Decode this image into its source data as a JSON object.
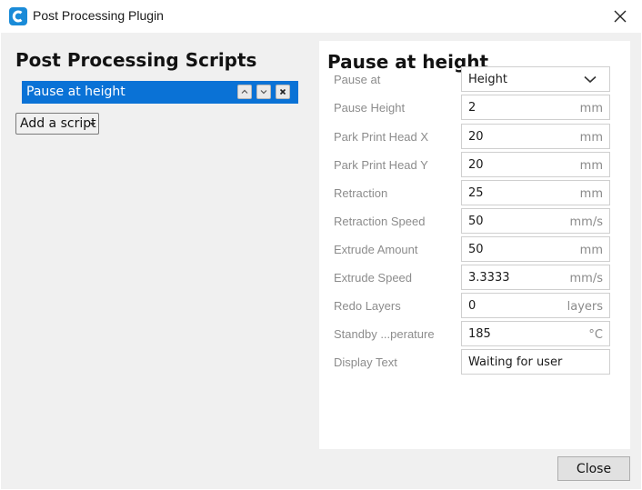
{
  "window": {
    "title": "Post Processing Plugin"
  },
  "scripts_panel": {
    "heading": "Post Processing Scripts",
    "items": [
      {
        "label": "Pause at height"
      }
    ],
    "add_script_label": "Add a script"
  },
  "settings": {
    "heading": "Pause at height",
    "pause_at": {
      "label": "Pause at",
      "value": "Height"
    },
    "rows": [
      {
        "label": "Pause Height",
        "value": "2",
        "unit": "mm"
      },
      {
        "label": "Park Print Head X",
        "value": "20",
        "unit": "mm"
      },
      {
        "label": "Park Print Head Y",
        "value": "20",
        "unit": "mm"
      },
      {
        "label": "Retraction",
        "value": "25",
        "unit": "mm"
      },
      {
        "label": "Retraction Speed",
        "value": "50",
        "unit": "mm/s"
      },
      {
        "label": "Extrude Amount",
        "value": "50",
        "unit": "mm"
      },
      {
        "label": "Extrude Speed",
        "value": "3.3333",
        "unit": "mm/s"
      },
      {
        "label": "Redo Layers",
        "value": "0",
        "unit": "layers"
      },
      {
        "label": "Standby ...perature",
        "value": "185",
        "unit": "°C"
      },
      {
        "label": "Display Text",
        "value": "Waiting for user",
        "unit": ""
      }
    ]
  },
  "footer": {
    "close_label": "Close"
  },
  "colors": {
    "accent": "#0a72d6",
    "app_icon": "#1a8bd8",
    "background": "#f0f0f0"
  },
  "icons": [
    "cura-logo-icon",
    "close-icon",
    "chevron-up-icon",
    "chevron-down-icon",
    "remove-icon",
    "dropdown-caret-icon"
  ]
}
